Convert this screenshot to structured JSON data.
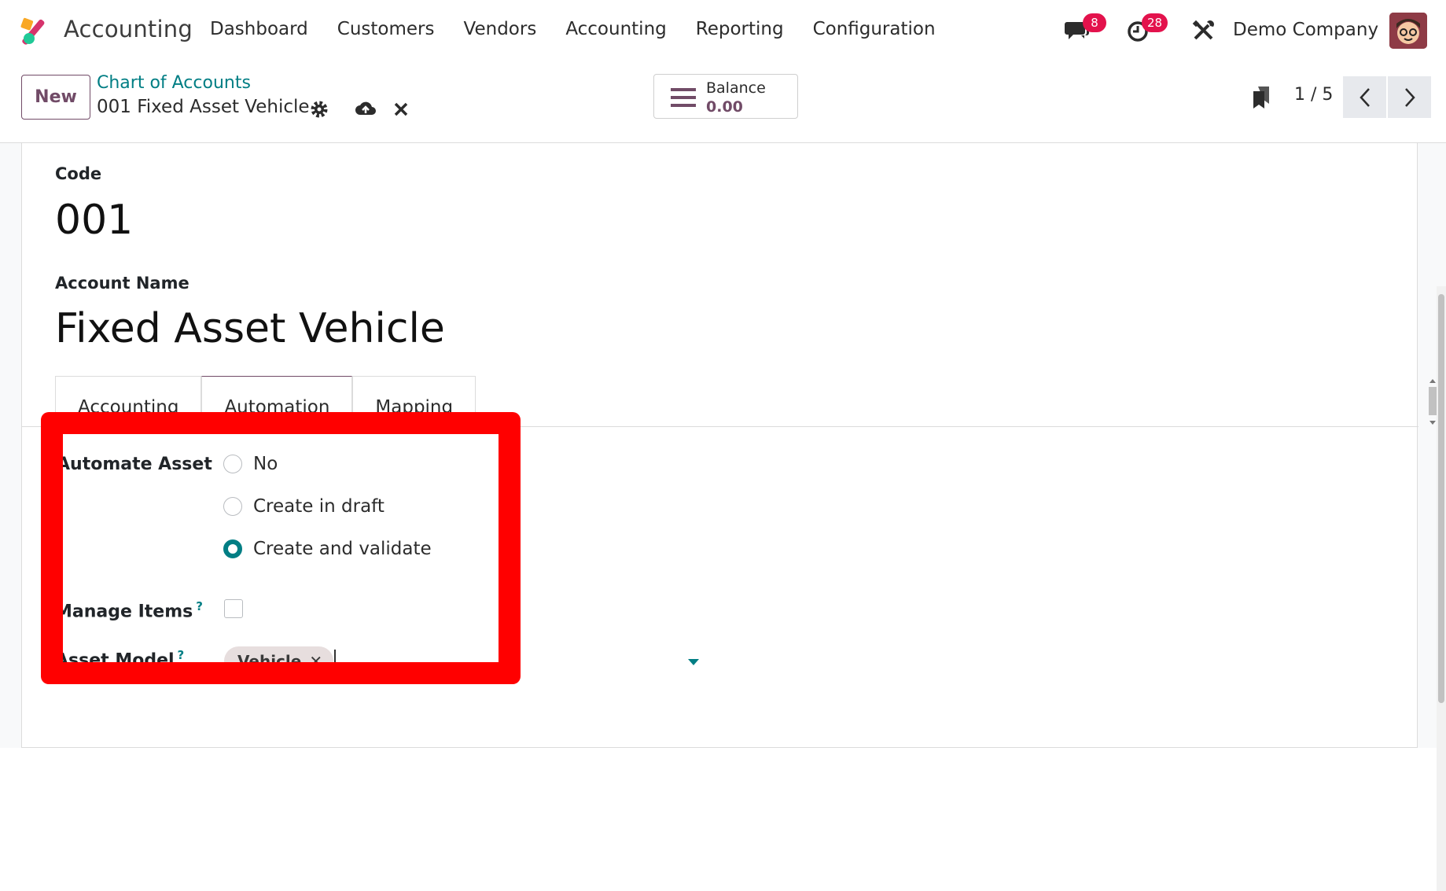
{
  "navbar": {
    "app_name": "Accounting",
    "menu": [
      "Dashboard",
      "Customers",
      "Vendors",
      "Accounting",
      "Reporting",
      "Configuration"
    ],
    "messages_count": "8",
    "activities_count": "28",
    "company": "Demo Company"
  },
  "control": {
    "new_label": "New",
    "breadcrumb_parent": "Chart of Accounts",
    "breadcrumb_current": "001 Fixed Asset Vehicle",
    "balance_label": "Balance",
    "balance_value": "0.00",
    "pager": "1 / 5"
  },
  "form": {
    "code_label": "Code",
    "code_value": "001",
    "name_label": "Account Name",
    "name_value": "Fixed Asset Vehicle",
    "tabs": [
      "Accounting",
      "Automation",
      "Mapping"
    ],
    "active_tab": "Automation",
    "automate_asset_label": "Automate Asset",
    "automate_options": [
      "No",
      "Create in draft",
      "Create and validate"
    ],
    "automate_selected": "Create and validate",
    "manage_items_label": "Manage Items",
    "manage_items_checked": false,
    "asset_model_label": "Asset Model",
    "asset_model_tag": "Vehicle",
    "help_mark": "?"
  },
  "colors": {
    "primary": "#714b67",
    "accent": "#017e84",
    "badge": "#e3124c",
    "highlight": "#ff0000"
  }
}
